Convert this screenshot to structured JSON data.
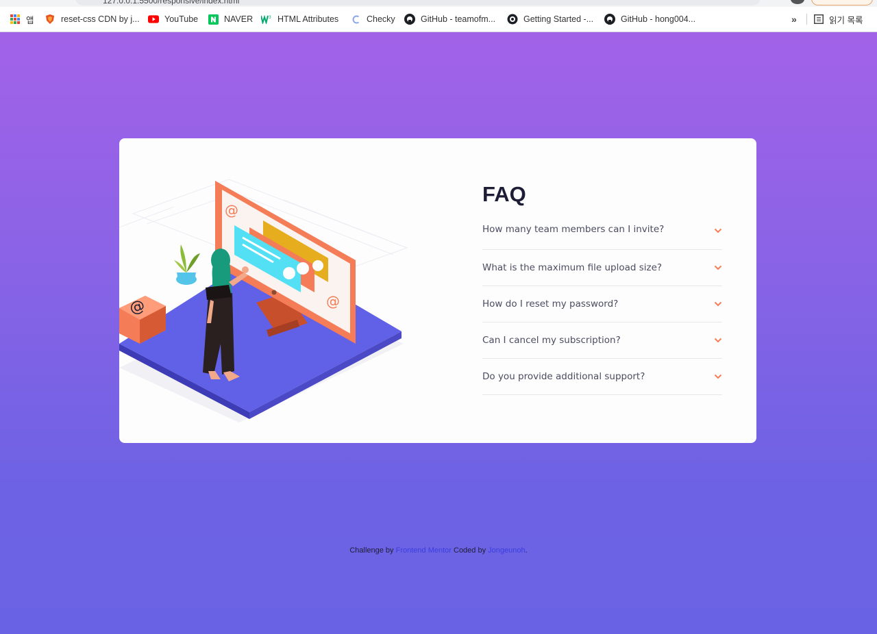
{
  "browser": {
    "url": "127.0.0.1:5500/responsive/index.html",
    "bookmarks": [
      {
        "label": "앱",
        "icon": "apps-icon"
      },
      {
        "label": "reset-css CDN by j...",
        "icon": "shield-icon"
      },
      {
        "label": "YouTube",
        "icon": "youtube-icon"
      },
      {
        "label": "NAVER",
        "icon": "naver-icon"
      },
      {
        "label": "HTML Attributes",
        "icon": "w3schools-icon"
      },
      {
        "label": "Checky",
        "icon": "checky-icon"
      },
      {
        "label": "GitHub - teamofm...",
        "icon": "github-icon"
      },
      {
        "label": "Getting Started -...",
        "icon": "site-icon"
      },
      {
        "label": "GitHub - hong004...",
        "icon": "github-icon"
      }
    ],
    "more_label": "»",
    "reading_list_label": "읽기 목록"
  },
  "colors": {
    "bg_top": "#a262e8",
    "bg_bottom": "#6a62e4",
    "card": "#fdfdfe",
    "chevron": "#f47c57",
    "heading": "#1d1e35",
    "question": "#4b4c5f",
    "link": "#3a3ee0"
  },
  "faq": {
    "title": "FAQ",
    "items": [
      {
        "question": "How many team members can I invite?"
      },
      {
        "question": "What is the maximum file upload size?"
      },
      {
        "question": "How do I reset my password?"
      },
      {
        "question": "Can I cancel my subscription?"
      },
      {
        "question": "Do you provide additional support?"
      }
    ]
  },
  "attribution": {
    "prefix": "Challenge by ",
    "mentor_link": "Frontend Mentor",
    "middle": " Coded by ",
    "author_link": "Jongeunoh",
    "suffix": "."
  }
}
